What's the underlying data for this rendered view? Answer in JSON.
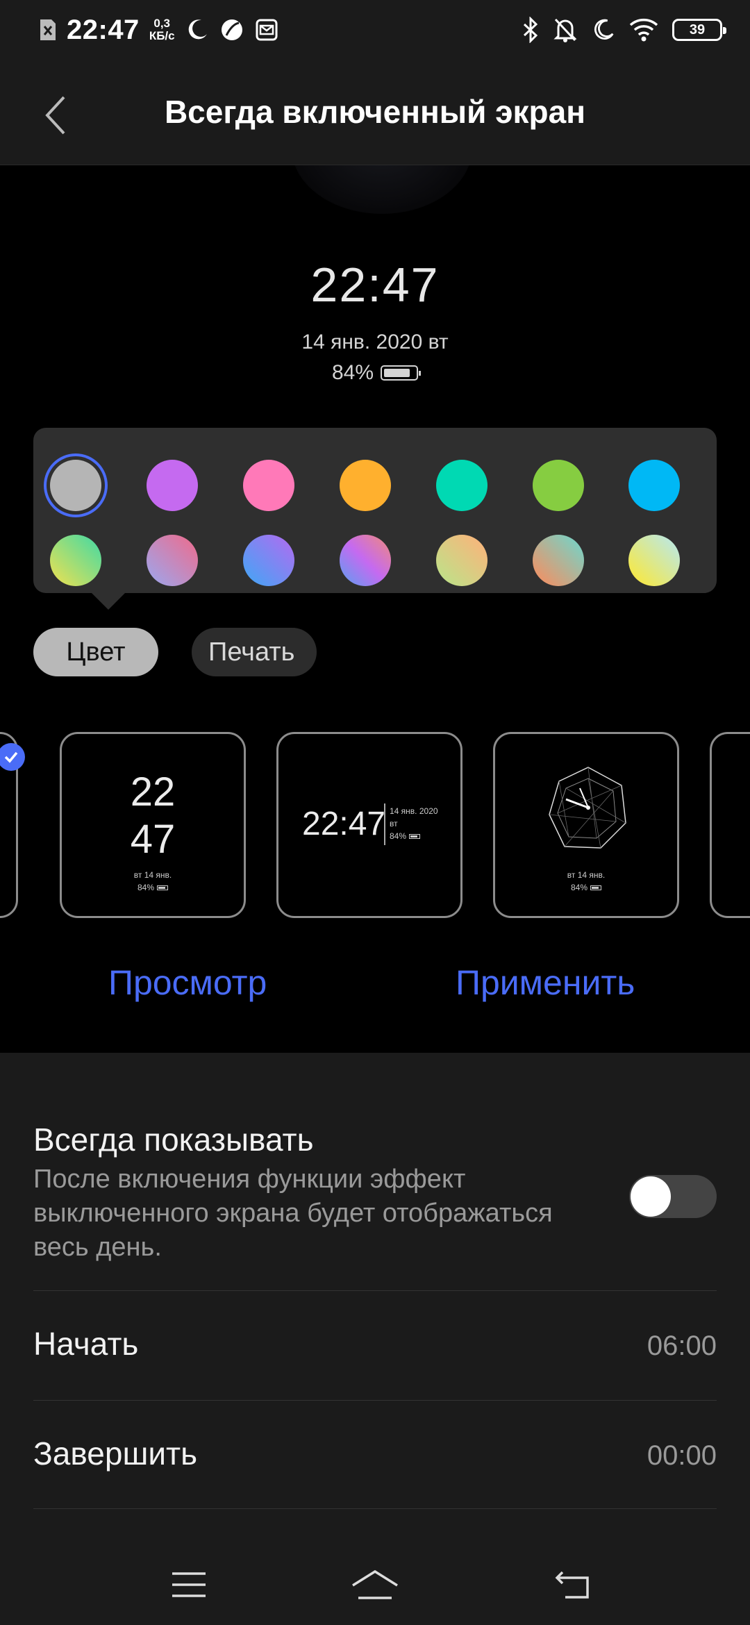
{
  "status_bar": {
    "time": "22:47",
    "speed_value": "0,3",
    "speed_unit": "КБ/с",
    "battery": "39"
  },
  "header": {
    "title": "Всегда включенный экран"
  },
  "preview": {
    "time": "22:47",
    "date": "14 янв. 2020 вт",
    "battery": "84%",
    "battery_level": 0.84
  },
  "palette": {
    "solid_colors": [
      "#b5b5b5",
      "#c56af0",
      "#ff79b8",
      "#ffb02e",
      "#00d9b3",
      "#86cd41",
      "#00b8f5"
    ],
    "gradient_colors": [
      [
        "#f2e14f",
        "#3fd9a6"
      ],
      [
        "#9aa8f0",
        "#f06a8a"
      ],
      [
        "#3fa8f5",
        "#b46af0"
      ],
      [
        "#5aa0f0",
        "#c56af0",
        "#f08a7a"
      ],
      [
        "#b8e68a",
        "#ffb07a"
      ],
      [
        "#ff8a5a",
        "#6ad9d0"
      ],
      [
        "#ffe82e",
        "#b5e8f5"
      ]
    ],
    "selected_index": 0
  },
  "tabs": {
    "color": "Цвет",
    "print": "Печать"
  },
  "styles": {
    "card2": {
      "hour": "22",
      "minute": "47",
      "date": "вт 14 янв.",
      "battery": "84%"
    },
    "card3": {
      "time": "22:47",
      "date": "14 янв. 2020",
      "day": "вт",
      "battery": "84%"
    },
    "card4": {
      "date": "вт 14 янв.",
      "battery": "84%"
    }
  },
  "actions": {
    "preview": "Просмотр",
    "apply": "Применить"
  },
  "settings": {
    "always_show_title": "Всегда показывать",
    "always_show_desc": "После включения функции эффект выключенного экрана будет отображаться весь день.",
    "always_show_enabled": false,
    "start_label": "Начать",
    "start_value": "06:00",
    "end_label": "Завершить",
    "end_value": "00:00"
  }
}
